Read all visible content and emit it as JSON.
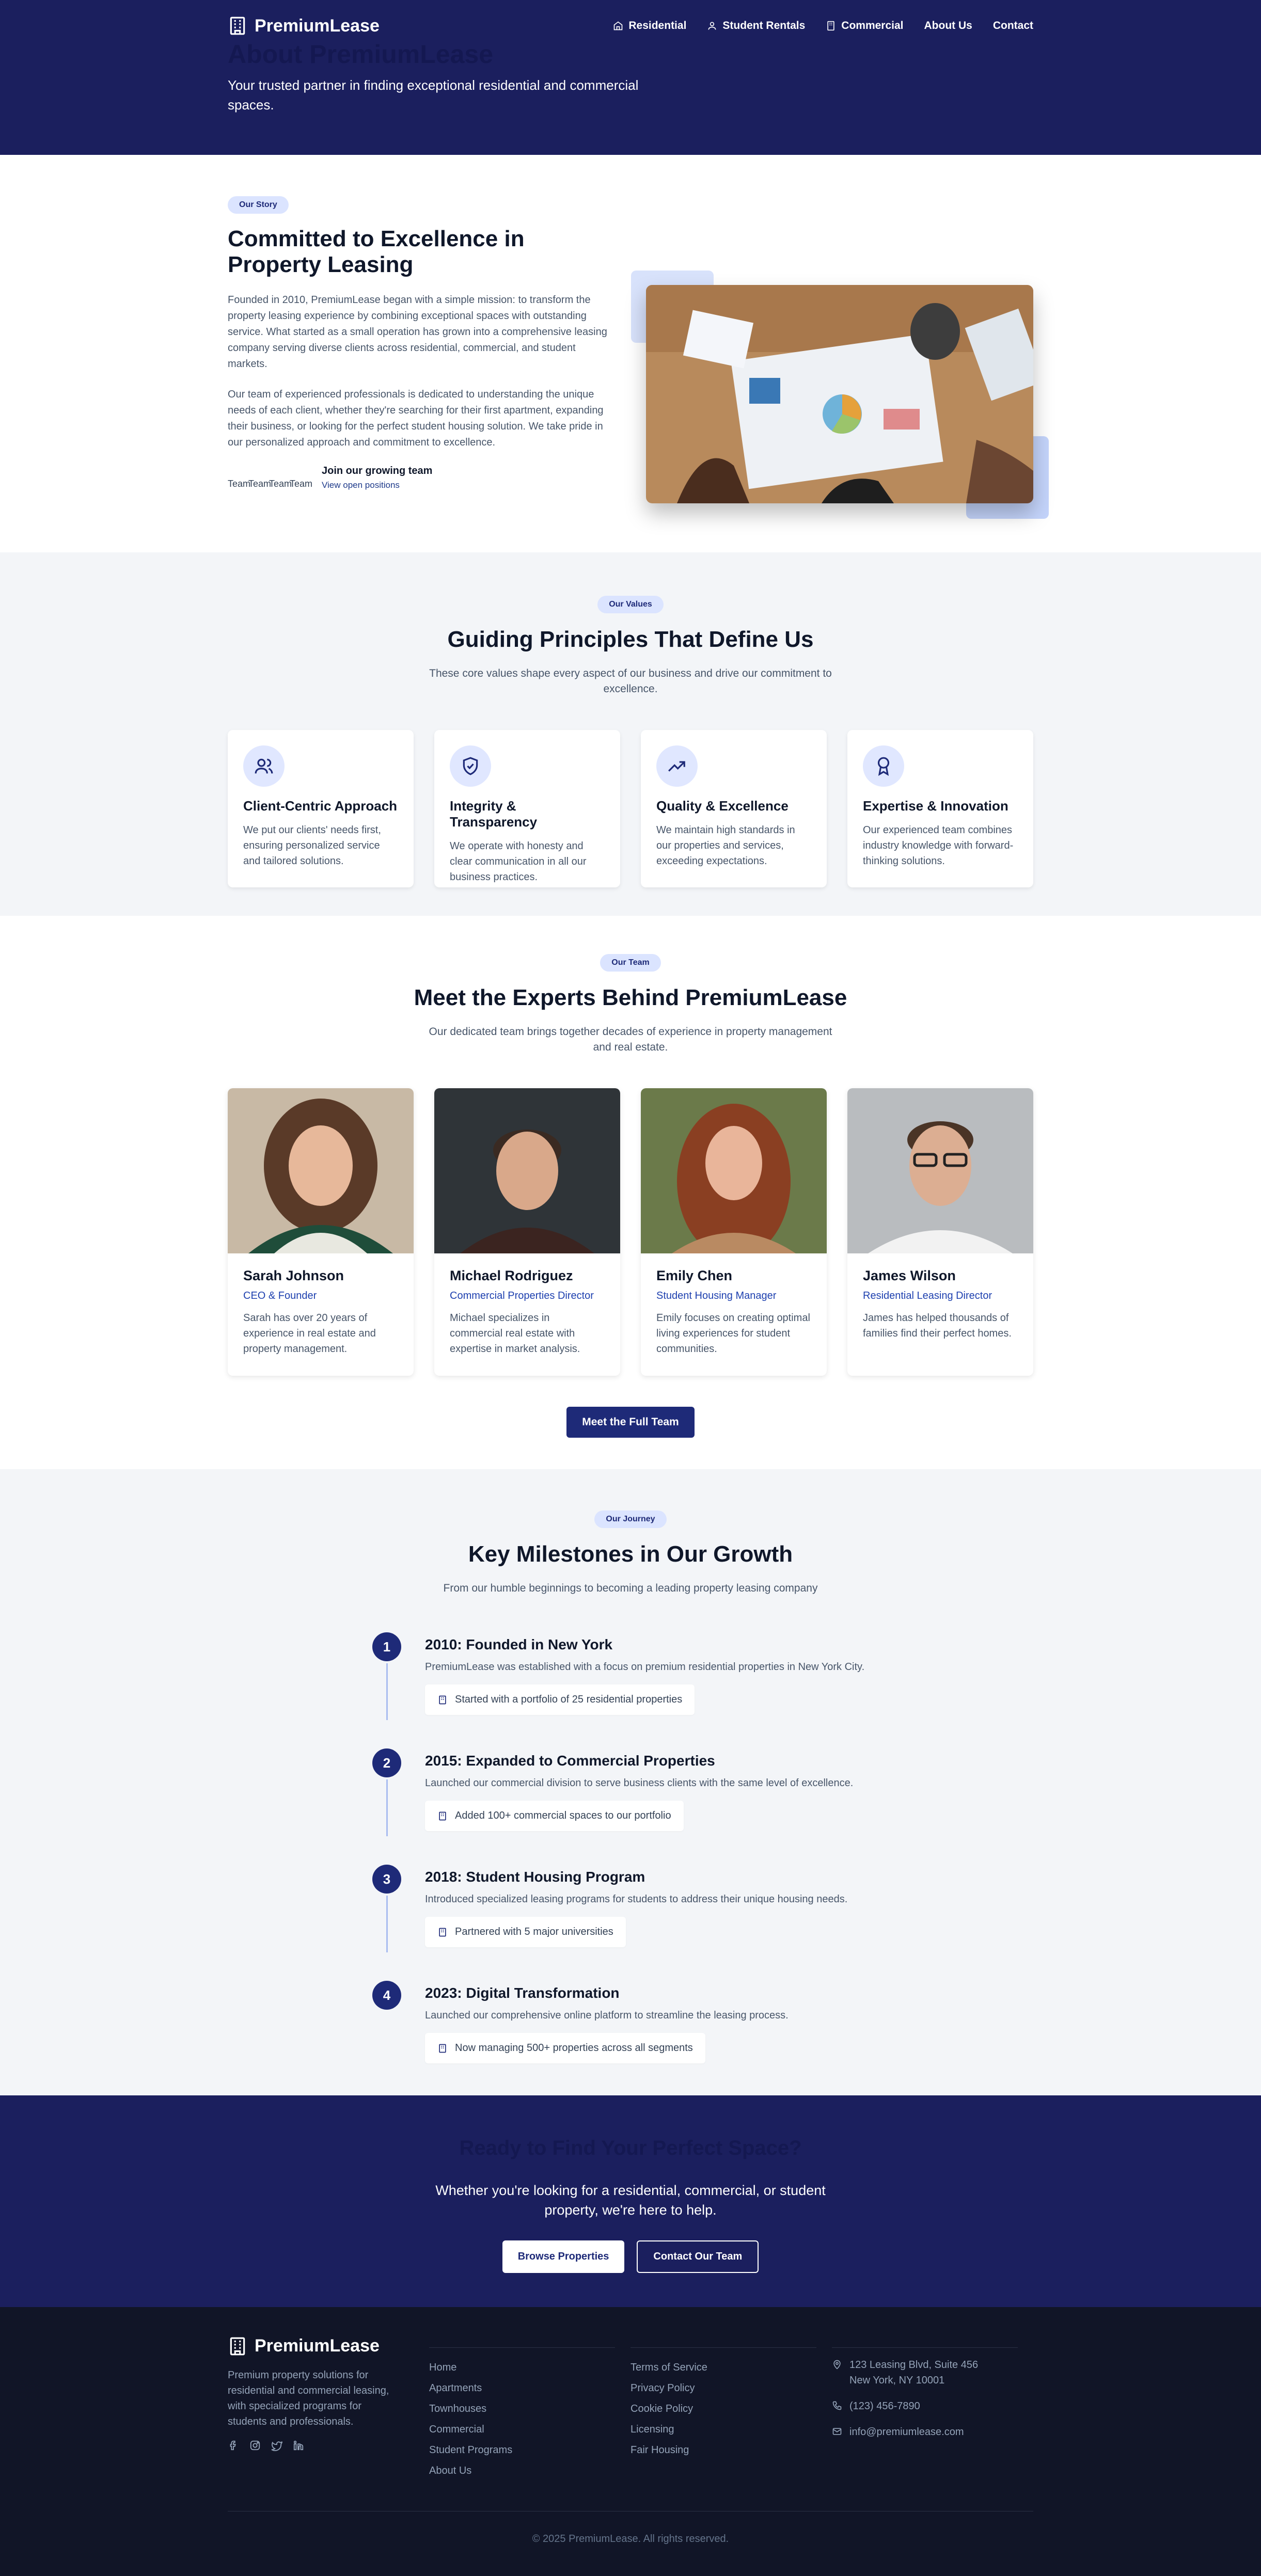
{
  "brand": {
    "name": "PremiumLease"
  },
  "nav": [
    {
      "label": "Residential",
      "icon": "home-icon"
    },
    {
      "label": "Student Rentals",
      "icon": "user-icon"
    },
    {
      "label": "Commercial",
      "icon": "building-icon"
    },
    {
      "label": "About Us"
    },
    {
      "label": "Contact"
    }
  ],
  "hero": {
    "title": "About PremiumLease",
    "subtitle": "Your trusted partner in finding exceptional residential and commercial spaces."
  },
  "story": {
    "pill": "Our Story",
    "title": "Committed to Excellence in Property Leasing",
    "p1": "Founded in 2010, PremiumLease began with a simple mission: to transform the property leasing experience by combining exceptional spaces with outstanding service. What started as a small operation has grown into a comprehensive leasing company serving diverse clients across residential, commercial, and student markets.",
    "p2": "Our team of experienced professionals is dedicated to understanding the unique needs of each client, whether they're searching for their first apartment, expanding their business, or looking for the perfect student housing solution. We take pride in our personalized approach and commitment to excellence.",
    "avatar_alt": [
      "Team",
      "Team",
      "Team",
      "Team"
    ],
    "join_title": "Join our growing team",
    "join_link": "View open positions"
  },
  "values": {
    "pill": "Our Values",
    "title": "Guiding Principles That Define Us",
    "desc": "These core values shape every aspect of our business and drive our commitment to excellence.",
    "items": [
      {
        "title": "Client-Centric Approach",
        "text": "We put our clients' needs first, ensuring personalized service and tailored solutions.",
        "icon": "users-icon"
      },
      {
        "title": "Integrity & Transparency",
        "text": "We operate with honesty and clear communication in all our business practices.",
        "icon": "shield-icon"
      },
      {
        "title": "Quality & Excellence",
        "text": "We maintain high standards in our properties and services, exceeding expectations.",
        "icon": "trending-up-icon"
      },
      {
        "title": "Expertise & Innovation",
        "text": "Our experienced team combines industry knowledge with forward-thinking solutions.",
        "icon": "award-icon"
      }
    ]
  },
  "team": {
    "pill": "Our Team",
    "title": "Meet the Experts Behind PremiumLease",
    "desc": "Our dedicated team brings together decades of experience in property management and real estate.",
    "members": [
      {
        "name": "Sarah Johnson",
        "role": "CEO & Founder",
        "bio": "Sarah has over 20 years of experience in real estate and property management."
      },
      {
        "name": "Michael Rodriguez",
        "role": "Commercial Properties Director",
        "bio": "Michael specializes in commercial real estate with expertise in market analysis."
      },
      {
        "name": "Emily Chen",
        "role": "Student Housing Manager",
        "bio": "Emily focuses on creating optimal living experiences for student communities."
      },
      {
        "name": "James Wilson",
        "role": "Residential Leasing Director",
        "bio": "James has helped thousands of families find their perfect homes."
      }
    ],
    "button": "Meet the Full Team"
  },
  "journey": {
    "pill": "Our Journey",
    "title": "Key Milestones in Our Growth",
    "desc": "From our humble beginnings to becoming a leading property leasing company",
    "milestones": [
      {
        "num": "1",
        "title": "2010: Founded in New York",
        "desc": "PremiumLease was established with a focus on premium residential properties in New York City.",
        "note": "Started with a portfolio of 25 residential properties"
      },
      {
        "num": "2",
        "title": "2015: Expanded to Commercial Properties",
        "desc": "Launched our commercial division to serve business clients with the same level of excellence.",
        "note": "Added 100+ commercial spaces to our portfolio"
      },
      {
        "num": "3",
        "title": "2018: Student Housing Program",
        "desc": "Introduced specialized leasing programs for students to address their unique housing needs.",
        "note": "Partnered with 5 major universities"
      },
      {
        "num": "4",
        "title": "2023: Digital Transformation",
        "desc": "Launched our comprehensive online platform to streamline the leasing process.",
        "note": "Now managing 500+ properties across all segments"
      }
    ]
  },
  "cta": {
    "title": "Ready to Find Your Perfect Space?",
    "text": "Whether you're looking for a residential, commercial, or student property, we're here to help.",
    "primary": "Browse Properties",
    "secondary": "Contact Our Team"
  },
  "footer": {
    "desc": "Premium property solutions for residential and commercial leasing, with specialized programs for students and professionals.",
    "links1": [
      "Home",
      "Apartments",
      "Townhouses",
      "Commercial",
      "Student Programs",
      "About Us"
    ],
    "links2": [
      "Terms of Service",
      "Privacy Policy",
      "Cookie Policy",
      "Licensing",
      "Fair Housing"
    ],
    "address1": "123 Leasing Blvd, Suite 456",
    "address2": "New York, NY 10001",
    "phone": "(123) 456-7890",
    "email": "info@premiumlease.com",
    "copyright": "© 2025 PremiumLease. All rights reserved."
  }
}
